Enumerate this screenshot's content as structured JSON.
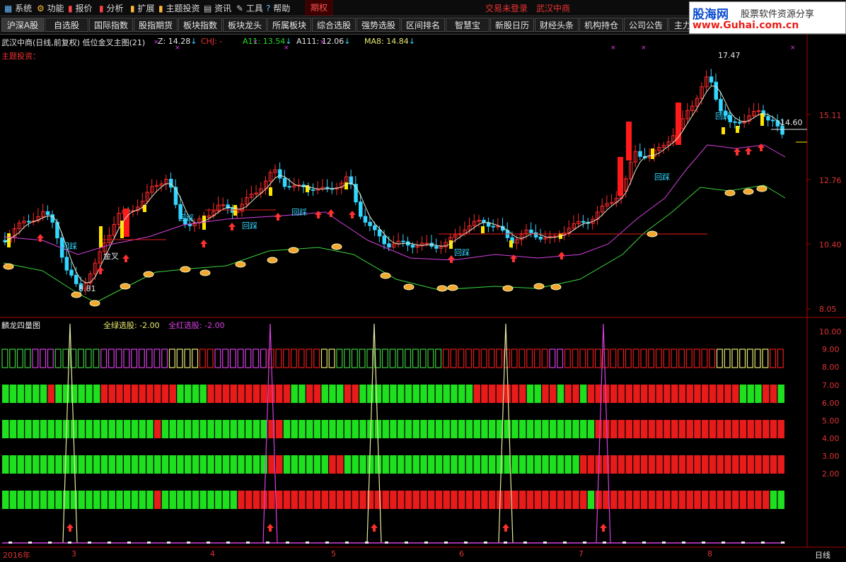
{
  "menu": [
    {
      "label": "系统",
      "icon": "grid-icon"
    },
    {
      "label": "功能",
      "icon": "gear-icon"
    },
    {
      "label": "报价",
      "icon": "chart-icon"
    },
    {
      "label": "分析",
      "icon": "chart-icon"
    },
    {
      "label": "扩展",
      "icon": "chart-icon"
    },
    {
      "label": "主题投资",
      "icon": "chart-icon"
    },
    {
      "label": "资讯",
      "icon": "news-icon"
    },
    {
      "label": "工具",
      "icon": "tool-icon"
    },
    {
      "label": "帮助",
      "icon": "help-icon"
    }
  ],
  "menu_tab": "期权",
  "status": {
    "login": "交易未登录",
    "stock": "武汉中商"
  },
  "logo": {
    "line1_a": "股海网",
    "line1_b": "股票软件资源分享",
    "line2": "www.Guhai.com.cn"
  },
  "toolbar": [
    "沪深A股",
    "自选股",
    "国际指数",
    "股指期货",
    "板块指数",
    "板块龙头",
    "所属板块",
    "综合选股",
    "强势选股",
    "区间排名",
    "智慧宝",
    "新股日历",
    "财经头条",
    "机构持仓",
    "公司公告",
    "主力"
  ],
  "main_chart": {
    "title": "武汉中商(日线,前复权) 低位金叉主图(21)",
    "z": "Z: 14.28",
    "chj": "CHJ: -",
    "a11": "A11: 13.54",
    "a111": "A111: 12.06",
    "ma8": "MA8: 14.84",
    "theme": "主题投资：",
    "high_label": "17.47",
    "low_label": "8.81",
    "current_price": "14.60",
    "annotations": [
      "回踩",
      "回踩",
      "回踩",
      "回踩",
      "回踩",
      "回踩",
      "回踩",
      "金叉"
    ],
    "y_ticks": [
      "15.11",
      "12.76",
      "10.40",
      "8.05"
    ]
  },
  "sub_chart": {
    "title": "麟龙四量图",
    "green": "全绿选股: -2.00",
    "red": "全红选股: -2.00",
    "y_ticks": [
      "10.00",
      "9.00",
      "8.00",
      "7.00",
      "6.00",
      "5.00",
      "4.00",
      "3.00",
      "2.00"
    ]
  },
  "x_axis": {
    "year": "2016年",
    "months": [
      "3",
      "4",
      "5",
      "6",
      "7",
      "8"
    ],
    "period": "日线"
  },
  "colors": {
    "up": "#ff2a2a",
    "down": "#33d6ff",
    "green": "#1fe01f",
    "red": "#e81b1b",
    "magenta": "#d640e0",
    "yellow": "#e8e870",
    "white": "#e8e8e8"
  }
}
